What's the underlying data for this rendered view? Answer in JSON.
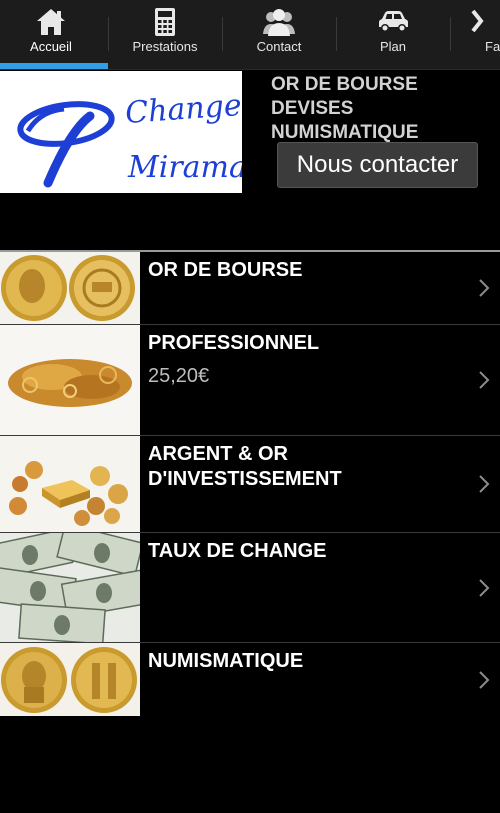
{
  "tabs": [
    {
      "label": "Accueil",
      "icon": "home-icon",
      "active": true
    },
    {
      "label": "Prestations",
      "icon": "calculator-icon",
      "active": false
    },
    {
      "label": "Contact",
      "icon": "people-icon",
      "active": false
    },
    {
      "label": "Plan",
      "icon": "car-icon",
      "active": false
    },
    {
      "label": "Fa",
      "icon": "more-icon",
      "active": false
    }
  ],
  "accent_color": "#2f9fe8",
  "logo": {
    "text_line1": "Change",
    "text_line2": "Miramar"
  },
  "header": {
    "title": "OR DE BOURSE DEVISES NUMISMATIQUE",
    "contact_button": "Nous contacter"
  },
  "items": [
    {
      "title": "OR DE BOURSE",
      "price": "",
      "image": "gold-coins-napoleon"
    },
    {
      "title": "PROFESSIONNEL",
      "price": "25,20€",
      "image": "scrap-gold-jewelry"
    },
    {
      "title": "ARGENT & OR D'INVESTISSEMENT",
      "price": "",
      "image": "gold-bar-and-coins"
    },
    {
      "title": "TAUX DE CHANGE",
      "price": "",
      "image": "dollar-banknotes"
    },
    {
      "title": "NUMISMATIQUE",
      "price": "",
      "image": "byzantine-gold-coins"
    }
  ]
}
